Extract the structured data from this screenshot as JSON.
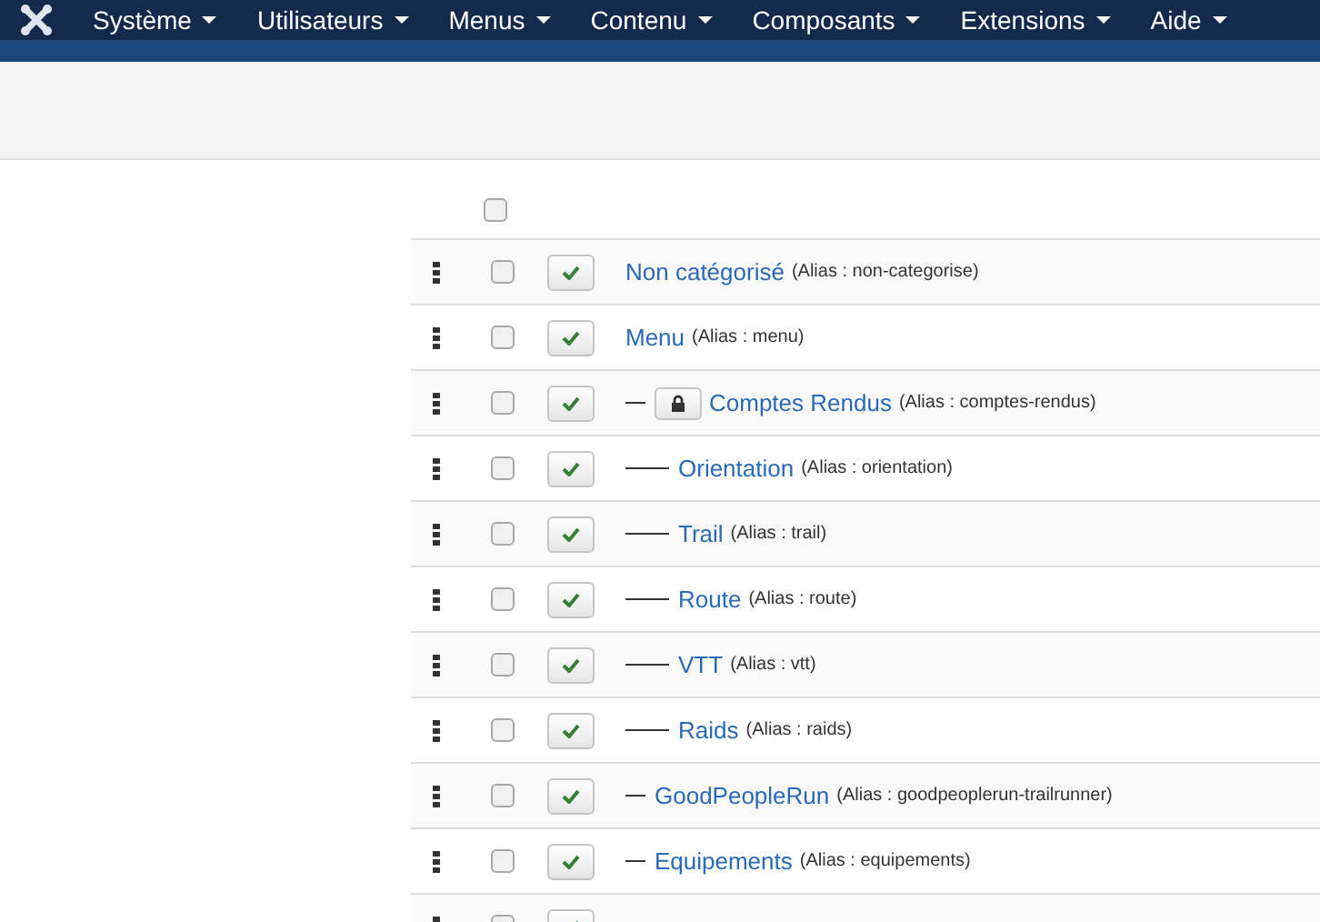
{
  "navbar": {
    "menus": [
      {
        "label": "Système"
      },
      {
        "label": "Utilisateurs"
      },
      {
        "label": "Menus"
      },
      {
        "label": "Contenu"
      },
      {
        "label": "Composants"
      },
      {
        "label": "Extensions"
      },
      {
        "label": "Aide"
      }
    ]
  },
  "table": {
    "select_all": {
      "checked": false
    },
    "rows": [
      {
        "title": "Non catégorisé",
        "alias": "(Alias : non-categorise)",
        "checked": false,
        "published": true,
        "locked": false
      },
      {
        "title": "Menu",
        "alias": "(Alias : menu)",
        "checked": false,
        "published": true,
        "locked": false,
        "children": [
          {
            "title": "Comptes Rendus",
            "alias": "(Alias : comptes-rendus)",
            "checked": false,
            "published": true,
            "locked": true,
            "children": [
              {
                "title": "Orientation",
                "alias": "(Alias : orientation)",
                "checked": false,
                "published": true,
                "locked": false
              },
              {
                "title": "Trail",
                "alias": "(Alias : trail)",
                "checked": false,
                "published": true,
                "locked": false
              },
              {
                "title": "Route",
                "alias": "(Alias : route)",
                "checked": false,
                "published": true,
                "locked": false
              },
              {
                "title": "VTT",
                "alias": "(Alias : vtt)",
                "checked": false,
                "published": true,
                "locked": false
              },
              {
                "title": "Raids",
                "alias": "(Alias : raids)",
                "checked": false,
                "published": true,
                "locked": false
              }
            ]
          },
          {
            "title": "GoodPeopleRun",
            "alias": "(Alias : goodpeoplerun-trailrunner)",
            "checked": false,
            "published": true,
            "locked": false
          },
          {
            "title": "Equipements",
            "alias": "(Alias : equipements)",
            "checked": false,
            "published": true,
            "locked": false
          },
          {
            "checked": false,
            "published": true,
            "locked": false
          }
        ]
      }
    ]
  }
}
